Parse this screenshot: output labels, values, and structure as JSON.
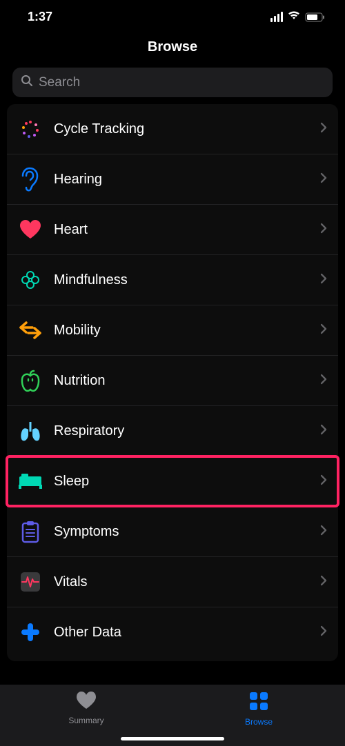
{
  "status": {
    "time": "1:37"
  },
  "header": {
    "title": "Browse"
  },
  "search": {
    "placeholder": "Search"
  },
  "categories": [
    {
      "id": "cycle-tracking",
      "label": "Cycle Tracking"
    },
    {
      "id": "hearing",
      "label": "Hearing"
    },
    {
      "id": "heart",
      "label": "Heart"
    },
    {
      "id": "mindfulness",
      "label": "Mindfulness"
    },
    {
      "id": "mobility",
      "label": "Mobility"
    },
    {
      "id": "nutrition",
      "label": "Nutrition"
    },
    {
      "id": "respiratory",
      "label": "Respiratory"
    },
    {
      "id": "sleep",
      "label": "Sleep",
      "highlighted": true
    },
    {
      "id": "symptoms",
      "label": "Symptoms"
    },
    {
      "id": "vitals",
      "label": "Vitals"
    },
    {
      "id": "other-data",
      "label": "Other Data"
    }
  ],
  "tabs": {
    "summary": {
      "label": "Summary",
      "active": false
    },
    "browse": {
      "label": "Browse",
      "active": true
    }
  },
  "colors": {
    "accent": "#0a7aff",
    "highlight": "#ff2262"
  }
}
